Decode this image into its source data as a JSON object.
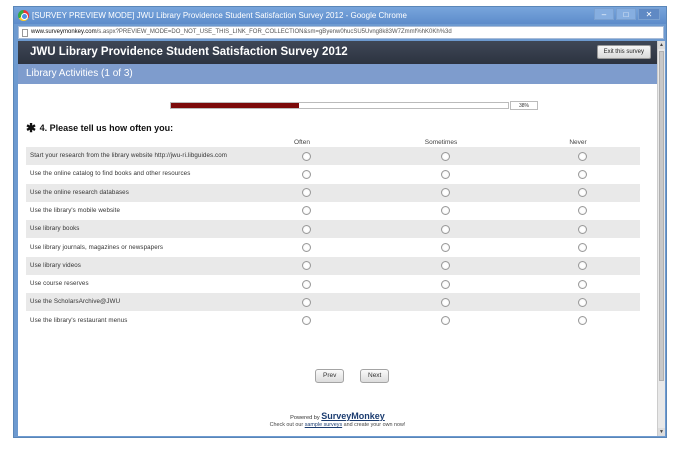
{
  "browser": {
    "title": "[SURVEY PREVIEW MODE] JWU Library Providence Student Satisfaction Survey 2012 - Google Chrome",
    "url_domain": "www.surveymonkey.com",
    "url_path": "/s.aspx?PREVIEW_MODE=DO_NOT_USE_THIS_LINK_FOR_COLLECTION&sm=gByenw0hucSU5Uvng8k83W7Zmmf%hK0Kh%3d",
    "minimize_label": "–",
    "maximize_label": "□",
    "close_label": "✕"
  },
  "survey": {
    "title": "JWU Library Providence Student Satisfaction Survey 2012",
    "exit_label": "Exit this survey",
    "page_title": "Library Activities (1 of 3)",
    "progress_fraction": 0.38,
    "progress_label": "38%",
    "question": {
      "star": "✱",
      "text": "4. Please tell us how often you:",
      "columns": [
        "Often",
        "Sometimes",
        "Never"
      ],
      "rows": [
        "Start your research from the library website http://jwu-ri.libguides.com",
        "Use the online catalog to find books and other resources",
        "Use the online research databases",
        "Use the library's mobile website",
        "Use library books",
        "Use library journals, magazines or newspapers",
        "Use library videos",
        "Use course reserves",
        "Use the ScholarsArchive@JWU",
        "Use the library's restaurant menus"
      ]
    },
    "prev_label": "Prev",
    "next_label": "Next"
  },
  "footer": {
    "powered_by": "Powered by",
    "brand": "SurveyMonkey",
    "promo_before": "Check out our",
    "promo_link": "sample surveys",
    "promo_after": "and create your own now!"
  },
  "colors": {
    "survey_header": "#2c3340",
    "page_header": "#7e9ccd",
    "progress_fill": "#7c0a0a",
    "window_frame": "#6d9ad0"
  }
}
